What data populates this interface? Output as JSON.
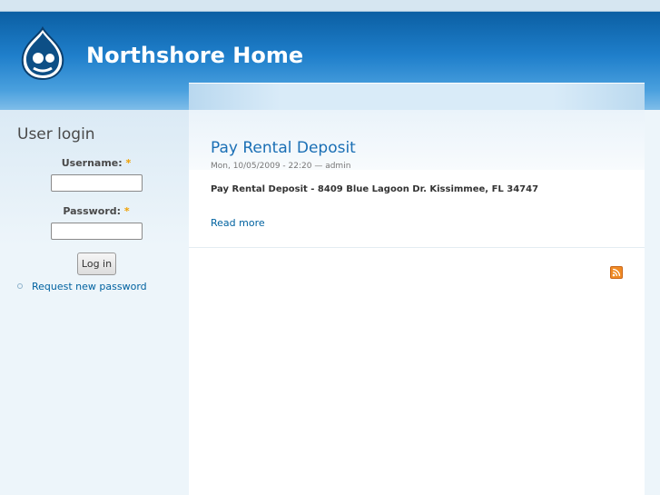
{
  "site": {
    "name": "Northshore Home",
    "logo_icon": "drupal-drop-logo-icon"
  },
  "login_block": {
    "title": "User login",
    "username_label": "Username:",
    "password_label": "Password:",
    "required_marker": "*",
    "username_value": "",
    "password_value": "",
    "login_button": "Log in",
    "request_password_link": "Request new password"
  },
  "node": {
    "title": "Pay Rental Deposit",
    "meta": "Mon, 10/05/2009 - 22:20 — admin",
    "body": "Pay Rental Deposit - 8409 Blue Lagoon Dr. Kissimmee, FL 34747",
    "read_more": "Read more"
  },
  "feed": {
    "icon": "rss-feed-icon"
  },
  "colors": {
    "header_blue": "#1f7fcb",
    "link_blue": "#0062a0",
    "feed_orange": "#f08a24"
  }
}
